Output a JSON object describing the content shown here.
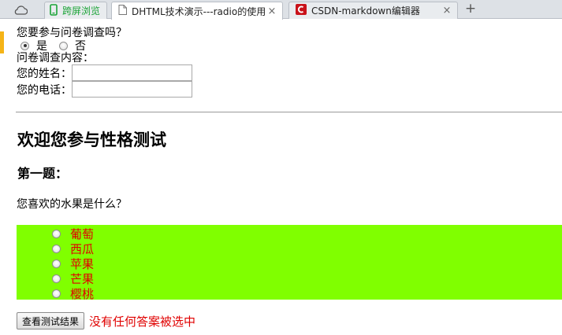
{
  "browser": {
    "tabs": [
      {
        "label": "跨屏浏览",
        "icon": "phone-icon",
        "color": "#1aa336"
      },
      {
        "label": "DHTML技术演示---radio的使用",
        "icon": "document-icon",
        "close": "×"
      },
      {
        "label": "CSDN-markdown编辑器",
        "icon": "csdn-icon",
        "icon_color": "#c9121a",
        "close": "×"
      }
    ],
    "new_tab": "+"
  },
  "survey": {
    "question": "您要参与问卷调查吗？",
    "yes": "是",
    "no": "否",
    "content_label": "问卷调查内容：",
    "name_label": "您的姓名：",
    "name_value": "",
    "phone_label": "您的电话：",
    "phone_value": ""
  },
  "test": {
    "title": "欢迎您参与性格测试",
    "q1_title": "第一题：",
    "q1_text": "您喜欢的水果是什么？",
    "options": [
      "葡萄",
      "西瓜",
      "苹果",
      "芒果",
      "樱桃"
    ],
    "options_bg": "#80ff00",
    "option_color": "#e00000",
    "button_label": "查看测试结果",
    "result_text": "没有任何答案被选中"
  }
}
